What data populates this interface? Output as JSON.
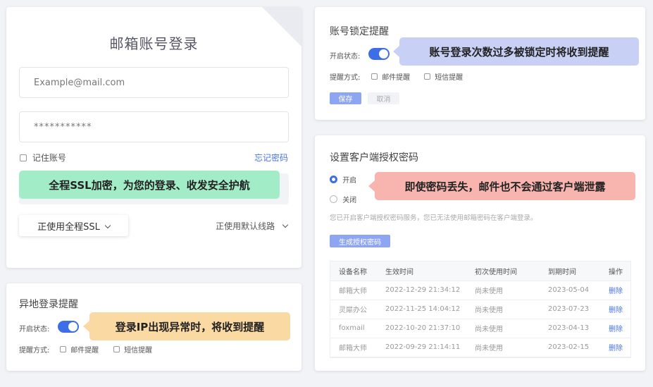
{
  "email_login": {
    "title": "邮箱账号登录",
    "email_placeholder": "Example@mail.com",
    "password_value": "***********",
    "remember_label": "记住账号",
    "forgot_label": "忘记密码",
    "ssl_callout": "全程SSL加密，为您的登录、收发安全护航",
    "ssl_dropdown": "正使用全程SSL",
    "route_dropdown": "正使用默认线路"
  },
  "remote_login_alert": {
    "title": "异地登录提醒",
    "status_label": "开启状态:",
    "toggle_on": true,
    "callout": "登录IP出现异常时，将收到提醒",
    "method_label": "提醒方式:",
    "option_email": "邮件提醒",
    "option_sms": "短信提醒"
  },
  "lock_alert": {
    "title": "账号锁定提醒",
    "status_label": "开启状态:",
    "toggle_on": true,
    "callout": "账号登录次数过多被锁定时将收到提醒",
    "method_label": "提醒方式:",
    "option_email": "邮件提醒",
    "option_sms": "短信提醒",
    "save_label": "保存",
    "cancel_label": "取消"
  },
  "client_auth": {
    "title": "设置客户端授权密码",
    "radio_on": "开启",
    "radio_off": "关闭",
    "callout": "即使密码丢失，邮件也不会通过客户端泄露",
    "description": "您已开启客户端授权密码服务，您已无法使用邮箱密码在客户端登录。",
    "generate_label": "生成授权密码",
    "columns": [
      "设备名称",
      "生效时间",
      "初次使用时间",
      "到期时间",
      "操作"
    ],
    "rows": [
      [
        "邮箱大师",
        "2022-12-29 21:34:12",
        "尚未使用",
        "2023-05-04",
        "删除"
      ],
      [
        "灵犀办公",
        "2022-11-25 14:04:12",
        "尚未使用",
        "2023-07-23",
        "删除"
      ],
      [
        "foxmail",
        "2022-10-20 21:37:10",
        "尚未使用",
        "2023-04-13",
        "删除"
      ],
      [
        "邮箱大师",
        "2022-09-29 21:14:11",
        "尚未使用",
        "2023-02-15",
        "删除"
      ]
    ]
  },
  "colors": {
    "accent": "#3d6ee8",
    "callout_green": "#a3ecc8",
    "callout_orange": "#fbd9a3",
    "callout_blue": "#c8d0f5",
    "callout_red": "#f8b5b0",
    "button_primary": "#8ea6f2"
  }
}
